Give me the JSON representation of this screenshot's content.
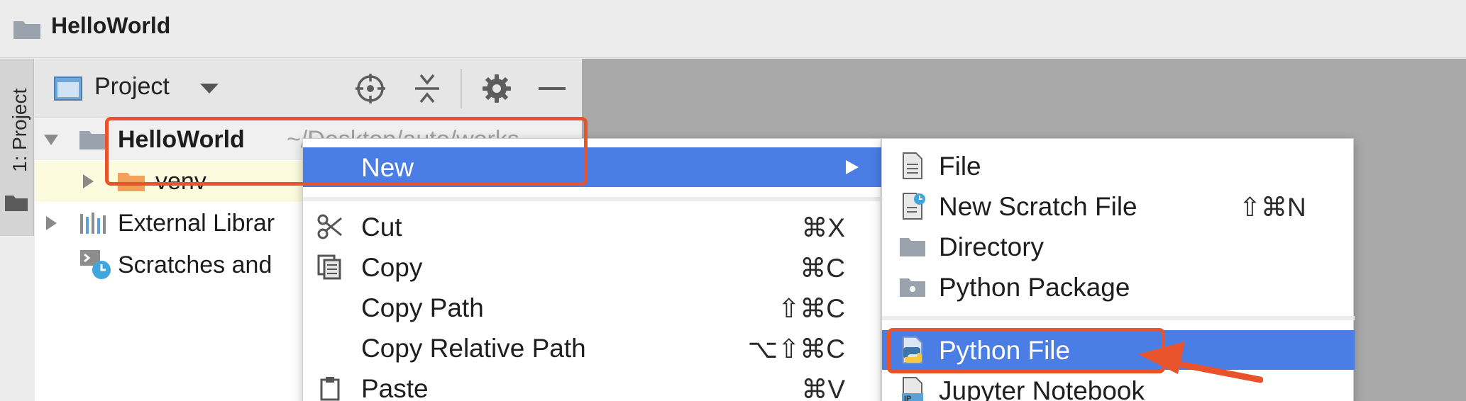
{
  "window": {
    "title": "HelloWorld"
  },
  "side_strip": {
    "label": "1: Project"
  },
  "panel": {
    "view_selector": "Project"
  },
  "tree": {
    "root_name": "HelloWorld",
    "root_path_hint": "~/Desktop/auto/works",
    "venv": "venv",
    "external_libraries": "External Librar",
    "scratches": "Scratches and"
  },
  "context_menu": {
    "new": "New",
    "items": [
      {
        "label": "Cut",
        "shortcut": "⌘X",
        "icon": "scissors-icon"
      },
      {
        "label": "Copy",
        "shortcut": "⌘C",
        "icon": "copy-icon"
      },
      {
        "label": "Copy Path",
        "shortcut": "⇧⌘C",
        "icon": ""
      },
      {
        "label": "Copy Relative Path",
        "shortcut": "⌥⇧⌘C",
        "icon": ""
      },
      {
        "label": "Paste",
        "shortcut": "⌘V",
        "icon": "clipboard-icon"
      }
    ]
  },
  "submenu": {
    "file": "File",
    "scratch": "New Scratch File",
    "scratch_shortcut": "⇧⌘N",
    "directory": "Directory",
    "python_package": "Python Package",
    "python_file": "Python File",
    "jupyter": "Jupyter Notebook",
    "jupyter_icon_text": "IP"
  },
  "colors": {
    "menu_highlight": "#4a7ee5",
    "annotation": "#e9532c",
    "selected_row": "#fdfbdd",
    "editor_background": "#a9a9a9"
  }
}
